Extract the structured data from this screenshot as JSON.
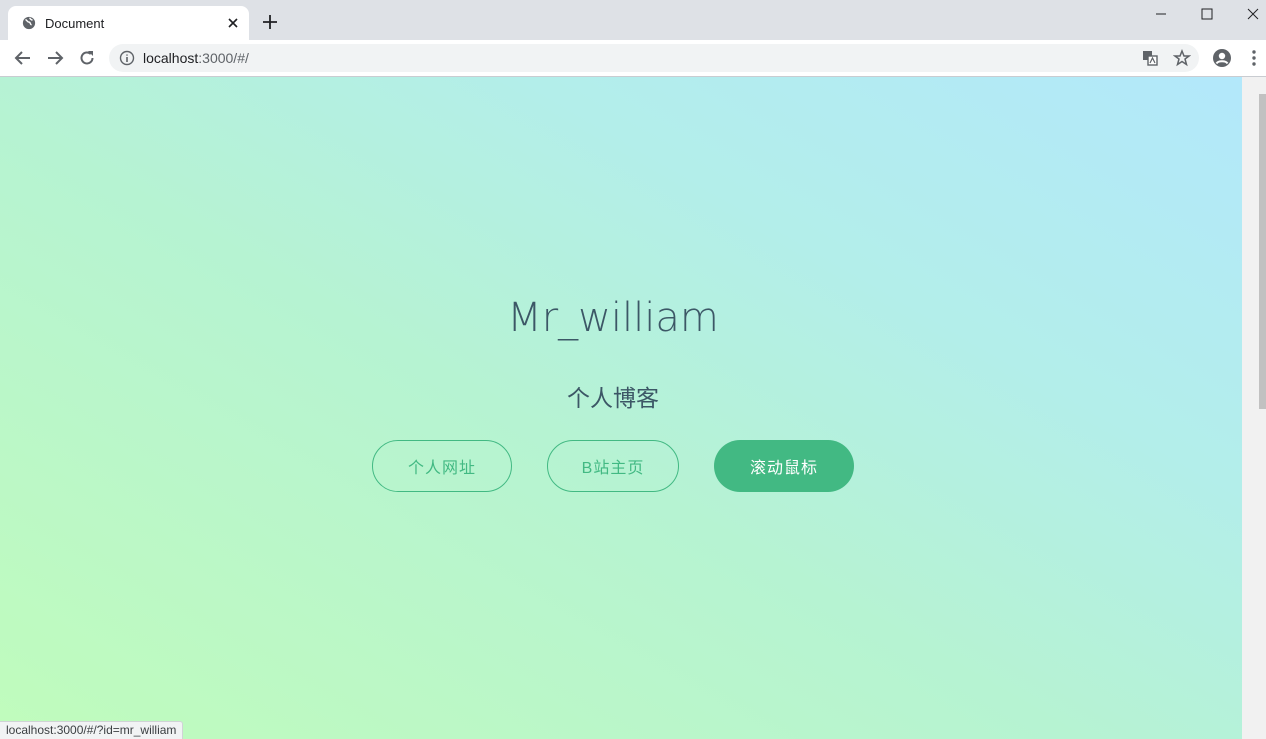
{
  "browser": {
    "tab_title": "Document",
    "url_host": "localhost",
    "url_path": ":3000/#/",
    "status_url": "localhost:3000/#/?id=mr_william",
    "icons": [
      "globe-icon",
      "close-icon",
      "plus-icon",
      "minimize-icon",
      "maximize-icon",
      "window-close-icon",
      "back-icon",
      "forward-icon",
      "reload-icon",
      "info-icon",
      "translate-icon",
      "star-icon",
      "account-icon",
      "more-icon"
    ]
  },
  "hero": {
    "title": "Mr_william",
    "subtitle": "个人博客",
    "buttons": [
      {
        "label": "个人网址"
      },
      {
        "label": "B站主页"
      },
      {
        "label": "滚动鼠标"
      }
    ]
  },
  "colors": {
    "accent": "#42b983",
    "text": "#3c5766",
    "gradient_start": "#c0fcbc",
    "gradient_end": "#b3e8fb"
  }
}
